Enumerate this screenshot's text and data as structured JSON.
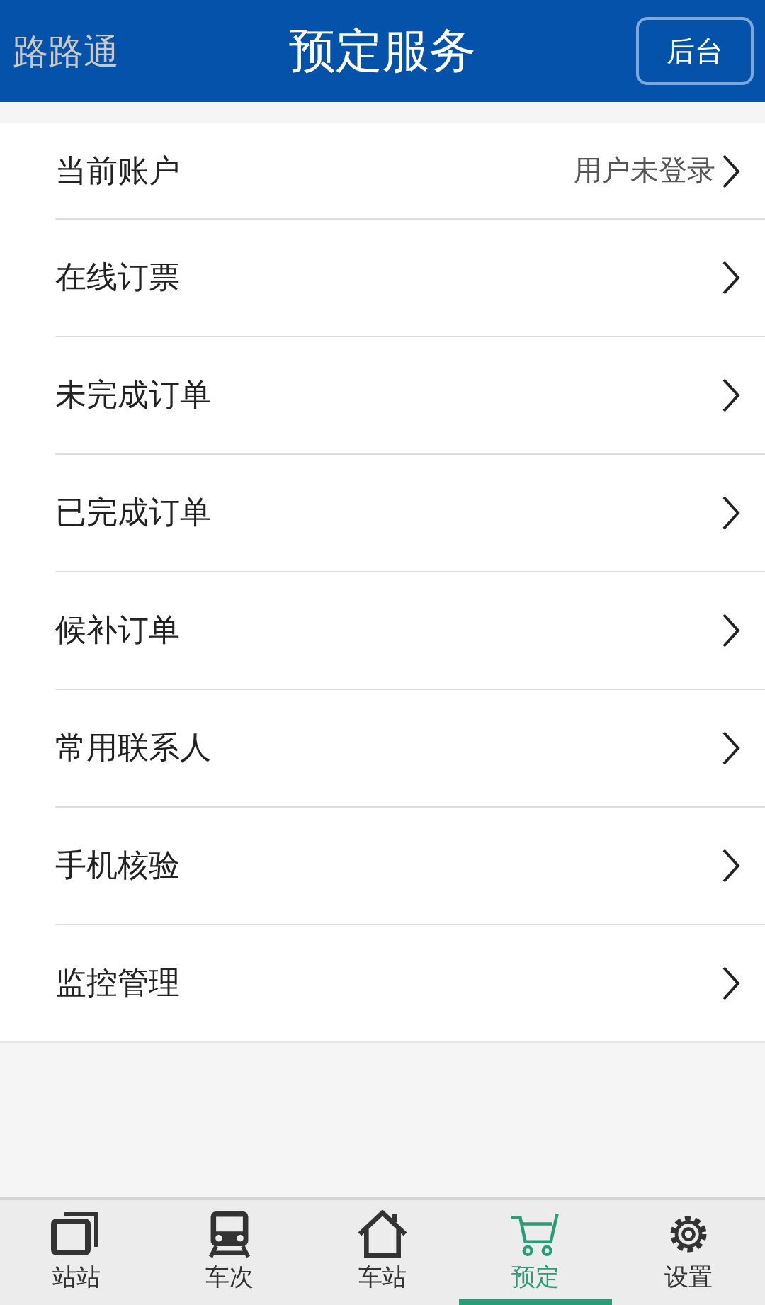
{
  "header": {
    "app_name": "路路通",
    "title": "预定服务",
    "action": "后台"
  },
  "menu": [
    {
      "label": "当前账户",
      "value": "用户未登录"
    },
    {
      "label": "在线订票"
    },
    {
      "label": "未完成订单"
    },
    {
      "label": "已完成订单"
    },
    {
      "label": "候补订单"
    },
    {
      "label": "常用联系人"
    },
    {
      "label": "手机核验"
    },
    {
      "label": "监控管理"
    }
  ],
  "tab_bar": [
    {
      "label": "站站",
      "kind": "stations",
      "selected": false
    },
    {
      "label": "车次",
      "kind": "train",
      "selected": false
    },
    {
      "label": "车站",
      "kind": "home",
      "selected": false
    },
    {
      "label": "预定",
      "kind": "cart",
      "selected": true
    },
    {
      "label": "设置",
      "kind": "gear",
      "selected": false
    }
  ]
}
